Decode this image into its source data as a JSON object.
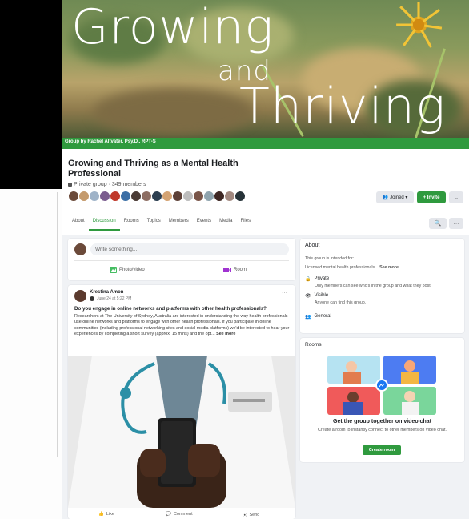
{
  "cover": {
    "line1": "Growing",
    "line2": "and",
    "line3": "Thriving",
    "byline": "Group by Rachel Altvater, Psy.D., RPT-S"
  },
  "group": {
    "title": "Growing and Thriving as a Mental Health Professional",
    "meta": "Private group · 349 members"
  },
  "buttons": {
    "joined": "Joined ▾",
    "invite": "+ Invite",
    "more": "⌄"
  },
  "tabs": [
    "About",
    "Discussion",
    "Rooms",
    "Topics",
    "Members",
    "Events",
    "Media",
    "Files"
  ],
  "active_tab": "Discussion",
  "composer": {
    "placeholder": "Write something...",
    "photo_video": "Photo/video",
    "room": "Room"
  },
  "post": {
    "author": "Krestina Amon",
    "date": "June 24 at 5:22 PM",
    "question": "Do you engage in online networks and platforms with other health professionals?",
    "body": "Researchers at The University of Sydney, Australia are interested in understanding the way health professionals use online networks and platforms to engage with other health professionals. If you participate in online communities (including professional networking sites and social media platforms) we'd be interested to hear your experiences by completing a short survey (approx. 15 mins) and the opt...",
    "see_more": "See more",
    "like": "Like",
    "comment": "Comment",
    "send": "Send"
  },
  "about": {
    "heading": "About",
    "intro": "This group is intended for:",
    "intro2": "Licensed mental health professionals...",
    "intro2_more": "See more",
    "private_title": "Private",
    "private_desc": "Only members can see who's in the group and what they post.",
    "visible_title": "Visible",
    "visible_desc": "Anyone can find this group.",
    "general": "General"
  },
  "rooms": {
    "heading": "Rooms",
    "title": "Get the group together on video chat",
    "desc": "Create a room to instantly connect to other members on video chat.",
    "button": "Create room"
  },
  "colors": {
    "accent": "#2f9a3e"
  }
}
